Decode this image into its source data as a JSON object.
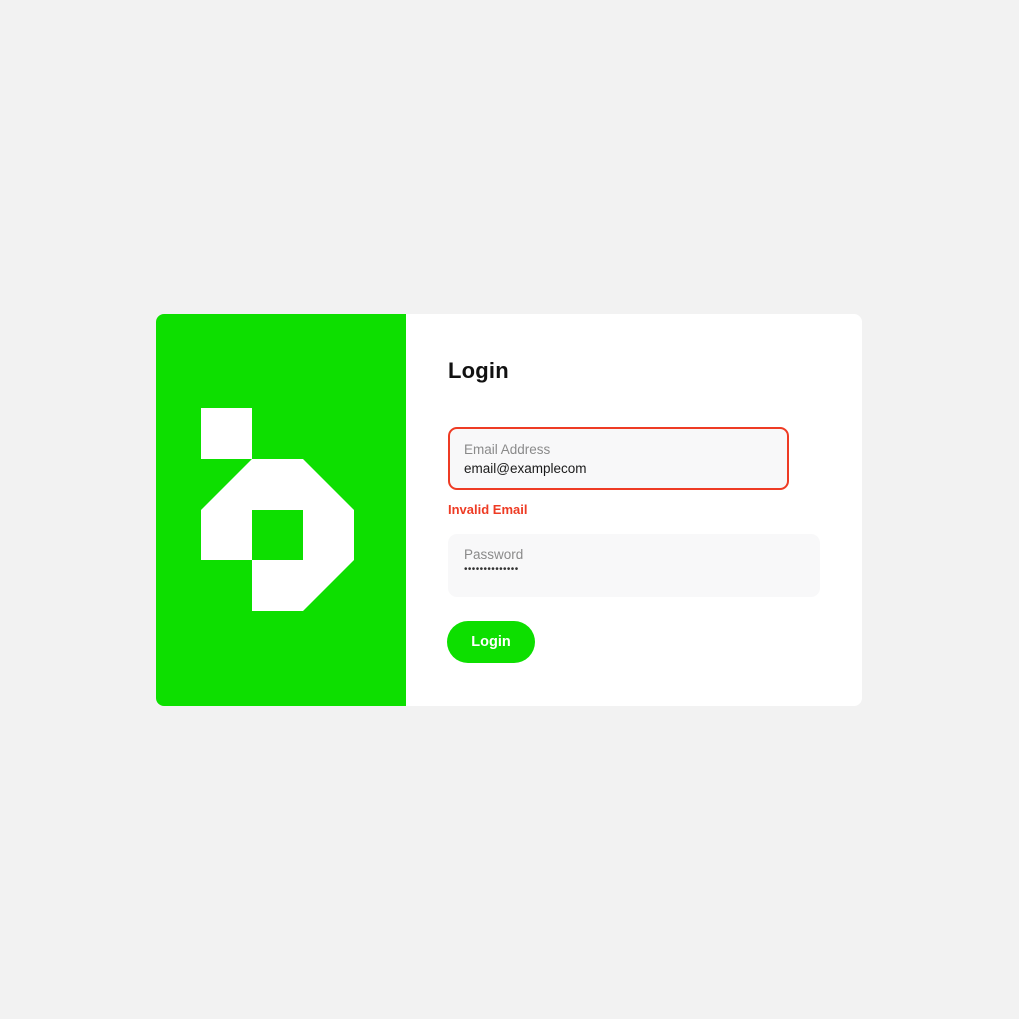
{
  "colors": {
    "brand_green": "#0ddf00",
    "error_red": "#ee3b24",
    "page_background": "#f2f2f2",
    "card_background": "#ffffff",
    "field_background": "#f8f8f9"
  },
  "brand": {
    "logo_icon": "pixel-logo-icon"
  },
  "login_form": {
    "title": "Login",
    "email": {
      "label": "Email Address",
      "value": "email@examplecom",
      "error": "Invalid Email"
    },
    "password": {
      "label": "Password",
      "value": "••••••••••••••"
    },
    "submit_label": "Login"
  }
}
